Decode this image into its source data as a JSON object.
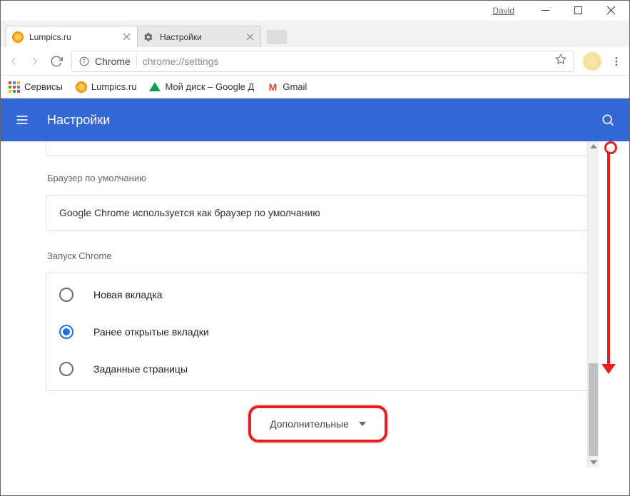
{
  "window": {
    "user": "David"
  },
  "tabs": [
    {
      "title": "Lumpics.ru",
      "icon": "orange-circle"
    },
    {
      "title": "Настройки",
      "icon": "gear"
    }
  ],
  "omnibox": {
    "info_label": "Chrome",
    "url": "chrome://settings"
  },
  "bookmarks": [
    {
      "label": "Сервисы",
      "icon": "apps"
    },
    {
      "label": "Lumpics.ru",
      "icon": "orange-circle"
    },
    {
      "label": "Мой диск – Google Д",
      "icon": "gdrive"
    },
    {
      "label": "Gmail",
      "icon": "gmail"
    }
  ],
  "header": {
    "title": "Настройки"
  },
  "sections": {
    "default_browser": {
      "label": "Браузер по умолчанию",
      "text": "Google Chrome используется как браузер по умолчанию"
    },
    "startup": {
      "label": "Запуск Chrome",
      "options": [
        {
          "label": "Новая вкладка",
          "checked": false
        },
        {
          "label": "Ранее открытые вкладки",
          "checked": true
        },
        {
          "label": "Заданные страницы",
          "checked": false
        }
      ]
    }
  },
  "advanced_button": "Дополнительные"
}
